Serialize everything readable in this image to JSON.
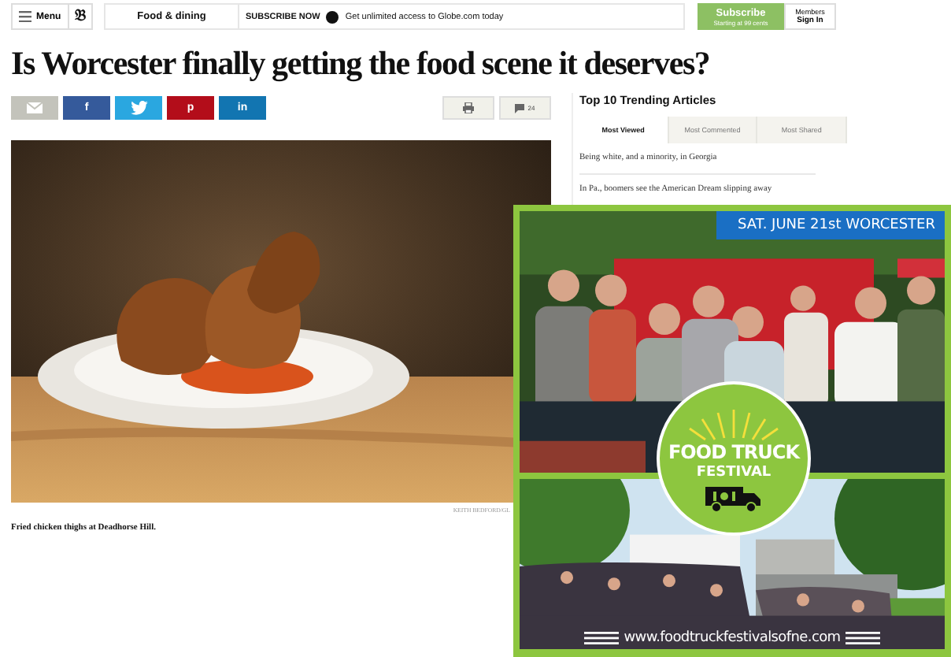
{
  "top_bar": {
    "menu": "Menu",
    "logo": "𝔅",
    "section": "Food & dining",
    "subscribe_now": "SUBSCRIBE NOW",
    "promo": "Get unlimited access to Globe.com today",
    "subscribe_button": {
      "label": "Subscribe",
      "sub": "Starting at 99 cents"
    },
    "members": {
      "line1": "Members",
      "line2": "Sign In"
    }
  },
  "headline": "Is Worcester finally getting the food scene it deserves?",
  "share_buttons": [
    {
      "kind": "email"
    },
    {
      "kind": "facebook",
      "glyph": "f"
    },
    {
      "kind": "twitter"
    },
    {
      "kind": "pinterest",
      "glyph": "p"
    },
    {
      "kind": "linkedin",
      "glyph": "in"
    }
  ],
  "tool_buttons": [
    {
      "kind": "print"
    },
    {
      "kind": "comments",
      "count": "24"
    }
  ],
  "photo": {
    "credit": "KEITH BEDFORD/GL",
    "caption": "Fried chicken thighs at Deadhorse Hill."
  },
  "sidebar": {
    "title": "Top 10 Trending Articles",
    "tabs": [
      {
        "label": "Most Viewed",
        "selected": true
      },
      {
        "label": "Most Commented",
        "selected": false
      },
      {
        "label": "Most Shared",
        "selected": false
      }
    ],
    "articles": [
      "Being white, and a minority, in Georgia",
      "In Pa., boomers see the American Dream slipping away"
    ]
  },
  "ad": {
    "date_banner": "SAT. JUNE 21st WORCESTER",
    "badge_line1": "FOOD TRUCK",
    "badge_line2": "FESTIVAL",
    "url": "www.foodtruckfestivalsofne.com"
  }
}
